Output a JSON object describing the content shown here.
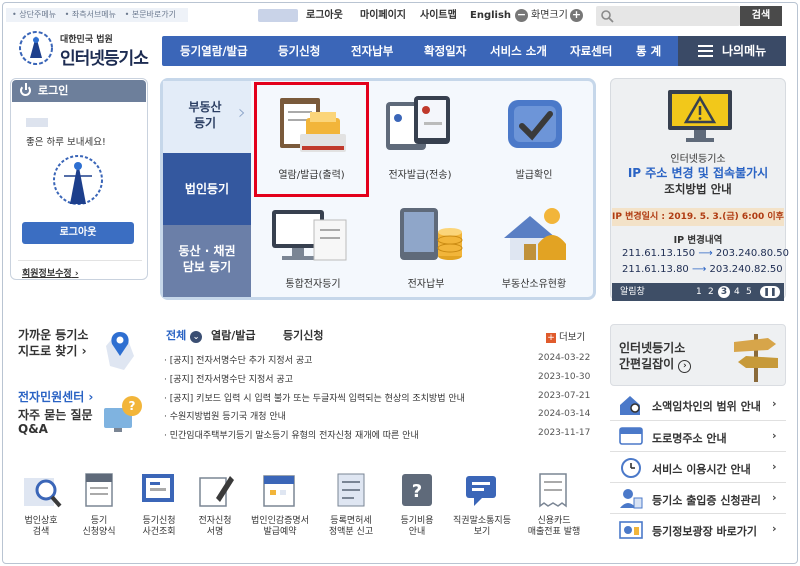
{
  "topbar": {
    "skip_links": [
      "• 상단주메뉴",
      "• 좌측서브메뉴",
      "• 본문바로가기"
    ],
    "logout": "로그아웃",
    "mypage": "마이페이지",
    "sitemap": "사이트맵",
    "english": "English",
    "zoom_label": "화면크기",
    "search_button": "검색"
  },
  "logo": {
    "small": "대한민국 법원",
    "big": "인터넷등기소"
  },
  "nav": {
    "items": [
      "등기열람/발급",
      "등기신청",
      "전자납부",
      "확정일자",
      "서비스 소개",
      "자료센터",
      "통 계"
    ],
    "my_menu": "나의메뉴"
  },
  "login": {
    "title": "로그인",
    "greeting": "좋은 하루 보내세요!",
    "logout_button": "로그아웃",
    "edit_info": "회원정보수정"
  },
  "services": {
    "categories": [
      {
        "label_1": "부동산",
        "label_2": "등기"
      },
      {
        "label_1": "법인등기",
        "label_2": ""
      },
      {
        "label_1": "동산 · 채권",
        "label_2": "담보 등기"
      }
    ],
    "items": [
      "열람/발급(출력)",
      "전자발급(전송)",
      "발급확인",
      "통합전자등기",
      "전자납부",
      "부동산소유현황"
    ],
    "highlight_color": "#e3001b"
  },
  "banner": {
    "line1": "인터넷등기소",
    "line2": "IP 주소 변경 및 접속불가시",
    "line3": "조치방법 안내",
    "date_line": "IP 변경일시 : 2019. 5. 3.(금) 6:00 이후",
    "ip_title": "IP 변경내역",
    "ip_rows": [
      {
        "from": "211.61.13.150",
        "to": "203.240.80.50"
      },
      {
        "from": "211.61.13.80",
        "to": "203.240.82.50"
      }
    ],
    "alert_label": "알림창",
    "pages": [
      "1",
      "2",
      "3",
      "4",
      "5"
    ]
  },
  "left_links": {
    "nearby": "가까운 등기소",
    "nearby2": "지도로 찾기",
    "civil": "전자민원센터",
    "faq": "자주 묻는 질문",
    "faq2": "Q&A"
  },
  "notices": {
    "tabs": [
      "전체",
      "열람/발급",
      "등기신청"
    ],
    "more": "더보기",
    "items": [
      {
        "title": "[공지] 전자서명수단 추가 지정서 공고",
        "date": "2024-03-22"
      },
      {
        "title": "[공지] 전자서명수단 지정서 공고",
        "date": "2023-10-30"
      },
      {
        "title": "[공지] 키보드 입력 시 입력 불가 또는 두글자씩 입력되는 현상의 조치방법 안내",
        "date": "2023-07-21"
      },
      {
        "title": "수원지방법원 등기국 개청 안내",
        "date": "2024-03-14"
      },
      {
        "title": "민간임대주택부기등기 말소등기 유형의 전자신청 재개에 따른 안내",
        "date": "2023-11-17"
      }
    ]
  },
  "guide": {
    "line1": "인터넷등기소",
    "line2": "간편길잡이"
  },
  "quick_menu": [
    "소액임차인의 범위 안내",
    "도로명주소 안내",
    "서비스 이용시간 안내",
    "등기소 출입증 신청관리",
    "등기정보광장 바로가기"
  ],
  "bottom_icons": [
    {
      "l1": "법인상호",
      "l2": "검색"
    },
    {
      "l1": "등기",
      "l2": "신청양식"
    },
    {
      "l1": "등기신청",
      "l2": "사건조회"
    },
    {
      "l1": "전자신청",
      "l2": "서명"
    },
    {
      "l1": "법인인감증명서",
      "l2": "발급예약"
    },
    {
      "l1": "등록면허세",
      "l2": "정액분 신고"
    },
    {
      "l1": "등기비용",
      "l2": "안내"
    },
    {
      "l1": "직권말소통지등",
      "l2": "보기"
    },
    {
      "l1": "신용카드",
      "l2": "매출전표 발행"
    }
  ]
}
